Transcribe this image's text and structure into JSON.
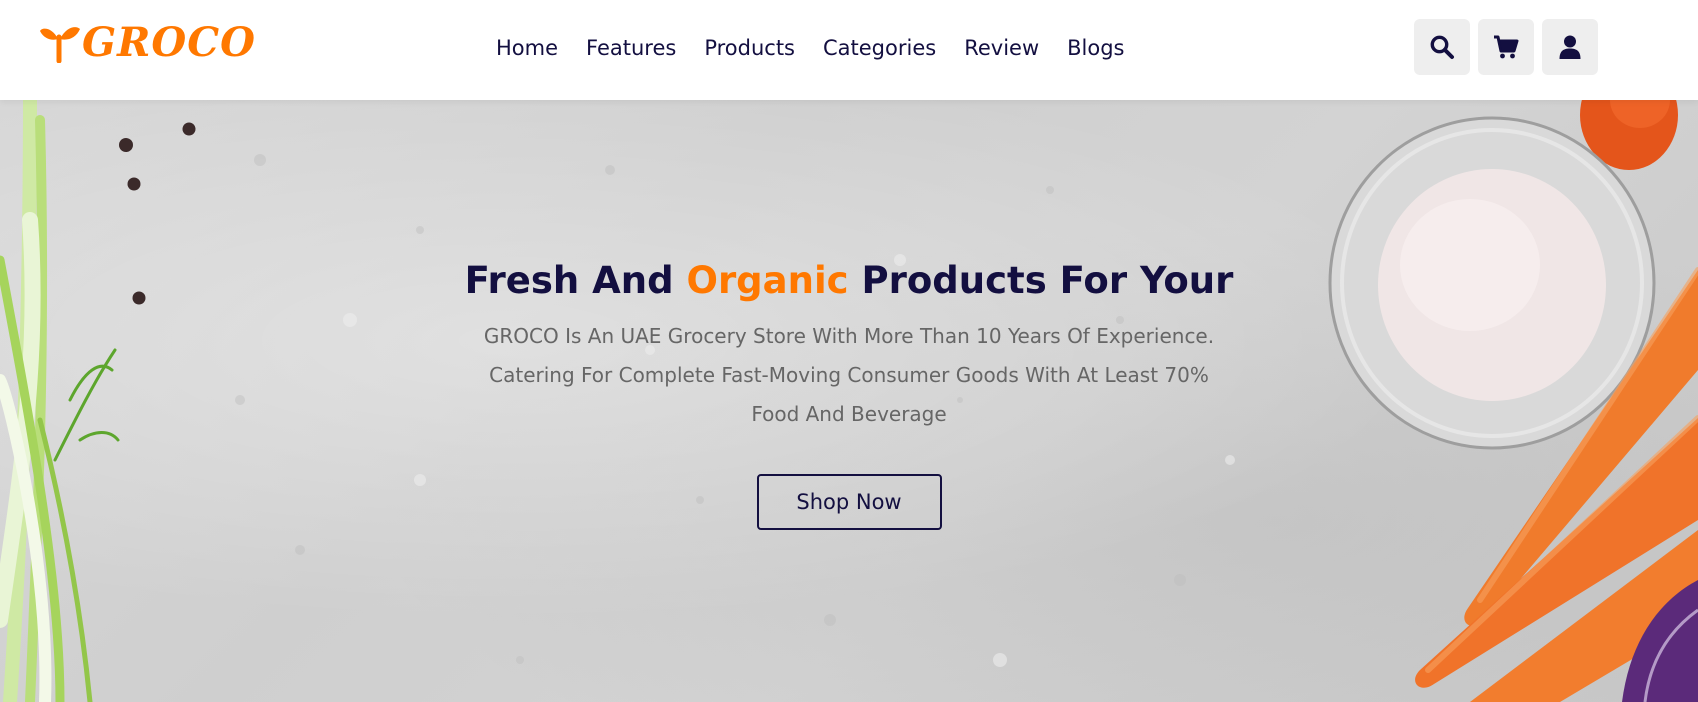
{
  "header": {
    "logo_text": "GROCO",
    "nav": [
      "Home",
      "Features",
      "Products",
      "Categories",
      "Review",
      "Blogs"
    ],
    "icons": [
      "search-icon",
      "cart-icon",
      "user-icon"
    ]
  },
  "hero": {
    "title_part1": "Fresh And ",
    "title_accent": "Organic",
    "title_part2": " Products For Your",
    "description": "GROCO Is An UAE Grocery Store With More Than 10 Years Of Experience. Catering For Complete Fast-Moving Consumer Goods With At Least 70% Food And Beverage",
    "button_label": "Shop Now"
  },
  "colors": {
    "accent": "#ff7800",
    "dark": "#130f40",
    "muted_text": "#666666",
    "icon_bg": "#eeeeee"
  }
}
